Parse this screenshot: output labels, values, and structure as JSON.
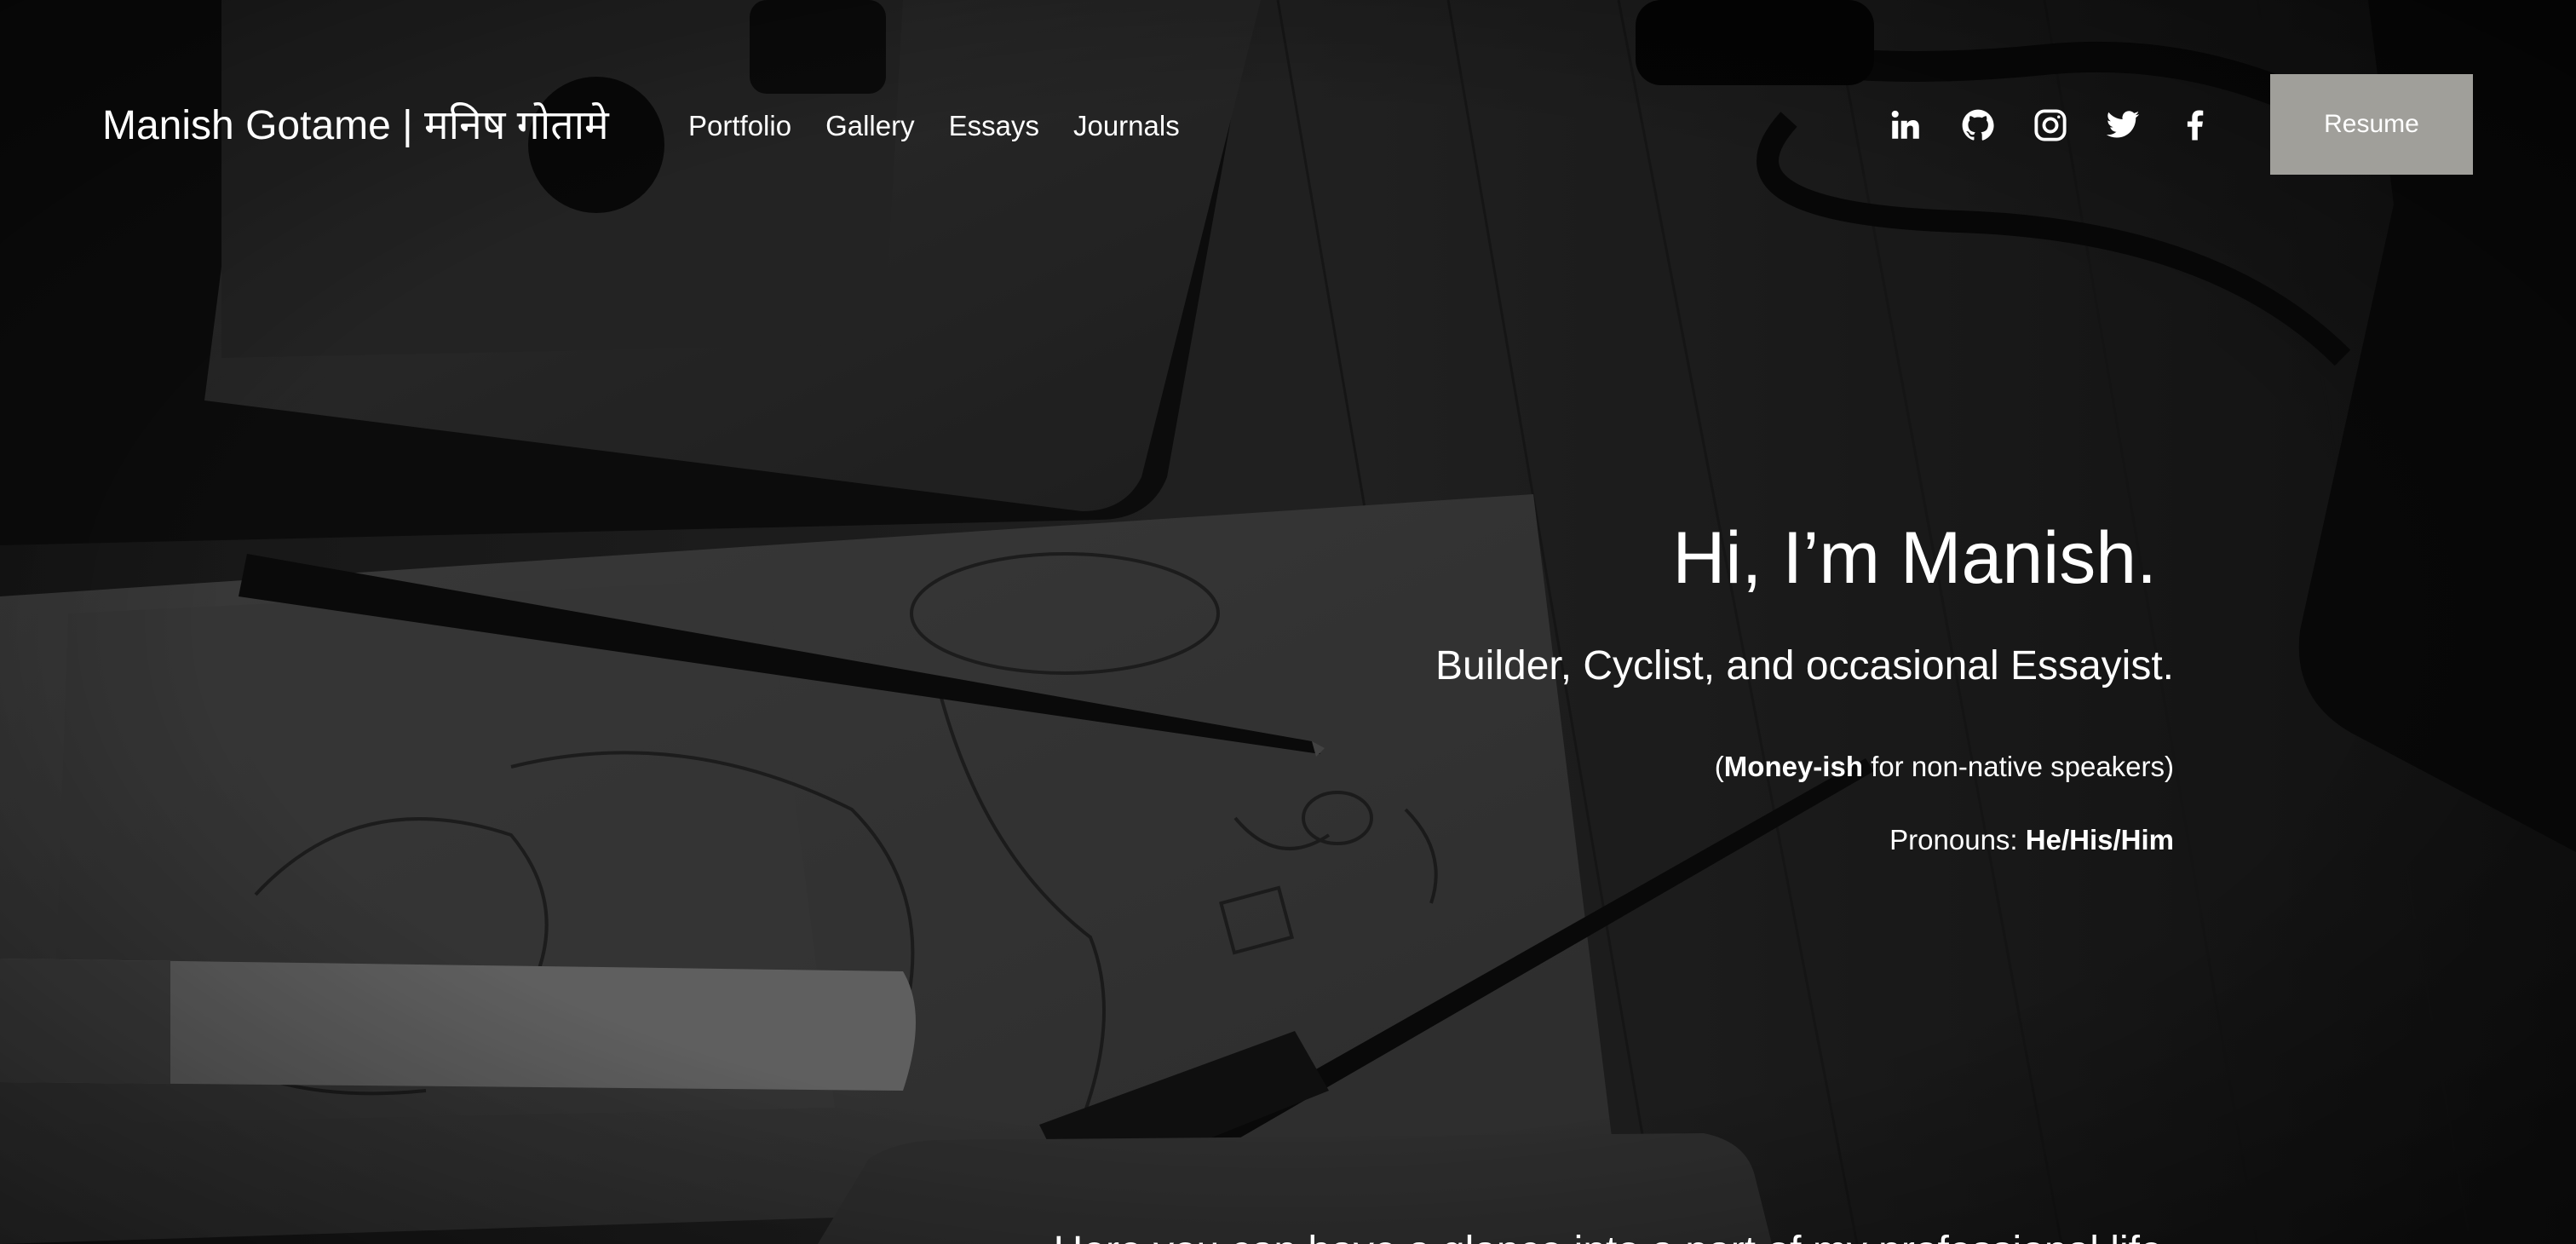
{
  "header": {
    "site_title": "Manish Gotame | मनिष गोतामे",
    "nav": [
      "Portfolio",
      "Gallery",
      "Essays",
      "Journals"
    ],
    "social_icons": [
      "linkedin-icon",
      "github-icon",
      "instagram-icon",
      "twitter-icon",
      "facebook-icon"
    ],
    "resume_label": "Resume"
  },
  "hero": {
    "title": "Hi, I’m Manish.",
    "subtitle": "Builder, Cyclist, and occasional Essayist.",
    "note_open": "(",
    "note_bold": "Money-ish",
    "note_rest": " for non-native speakers)",
    "pronouns_label": "Pronouns: ",
    "pronouns_value": "He/His/Him"
  },
  "glance_text": "Here you can have a glance into a part of my professional life.",
  "colors": {
    "resume_button_bg": "#a09f9a",
    "text": "#ffffff",
    "background": "#141414"
  }
}
